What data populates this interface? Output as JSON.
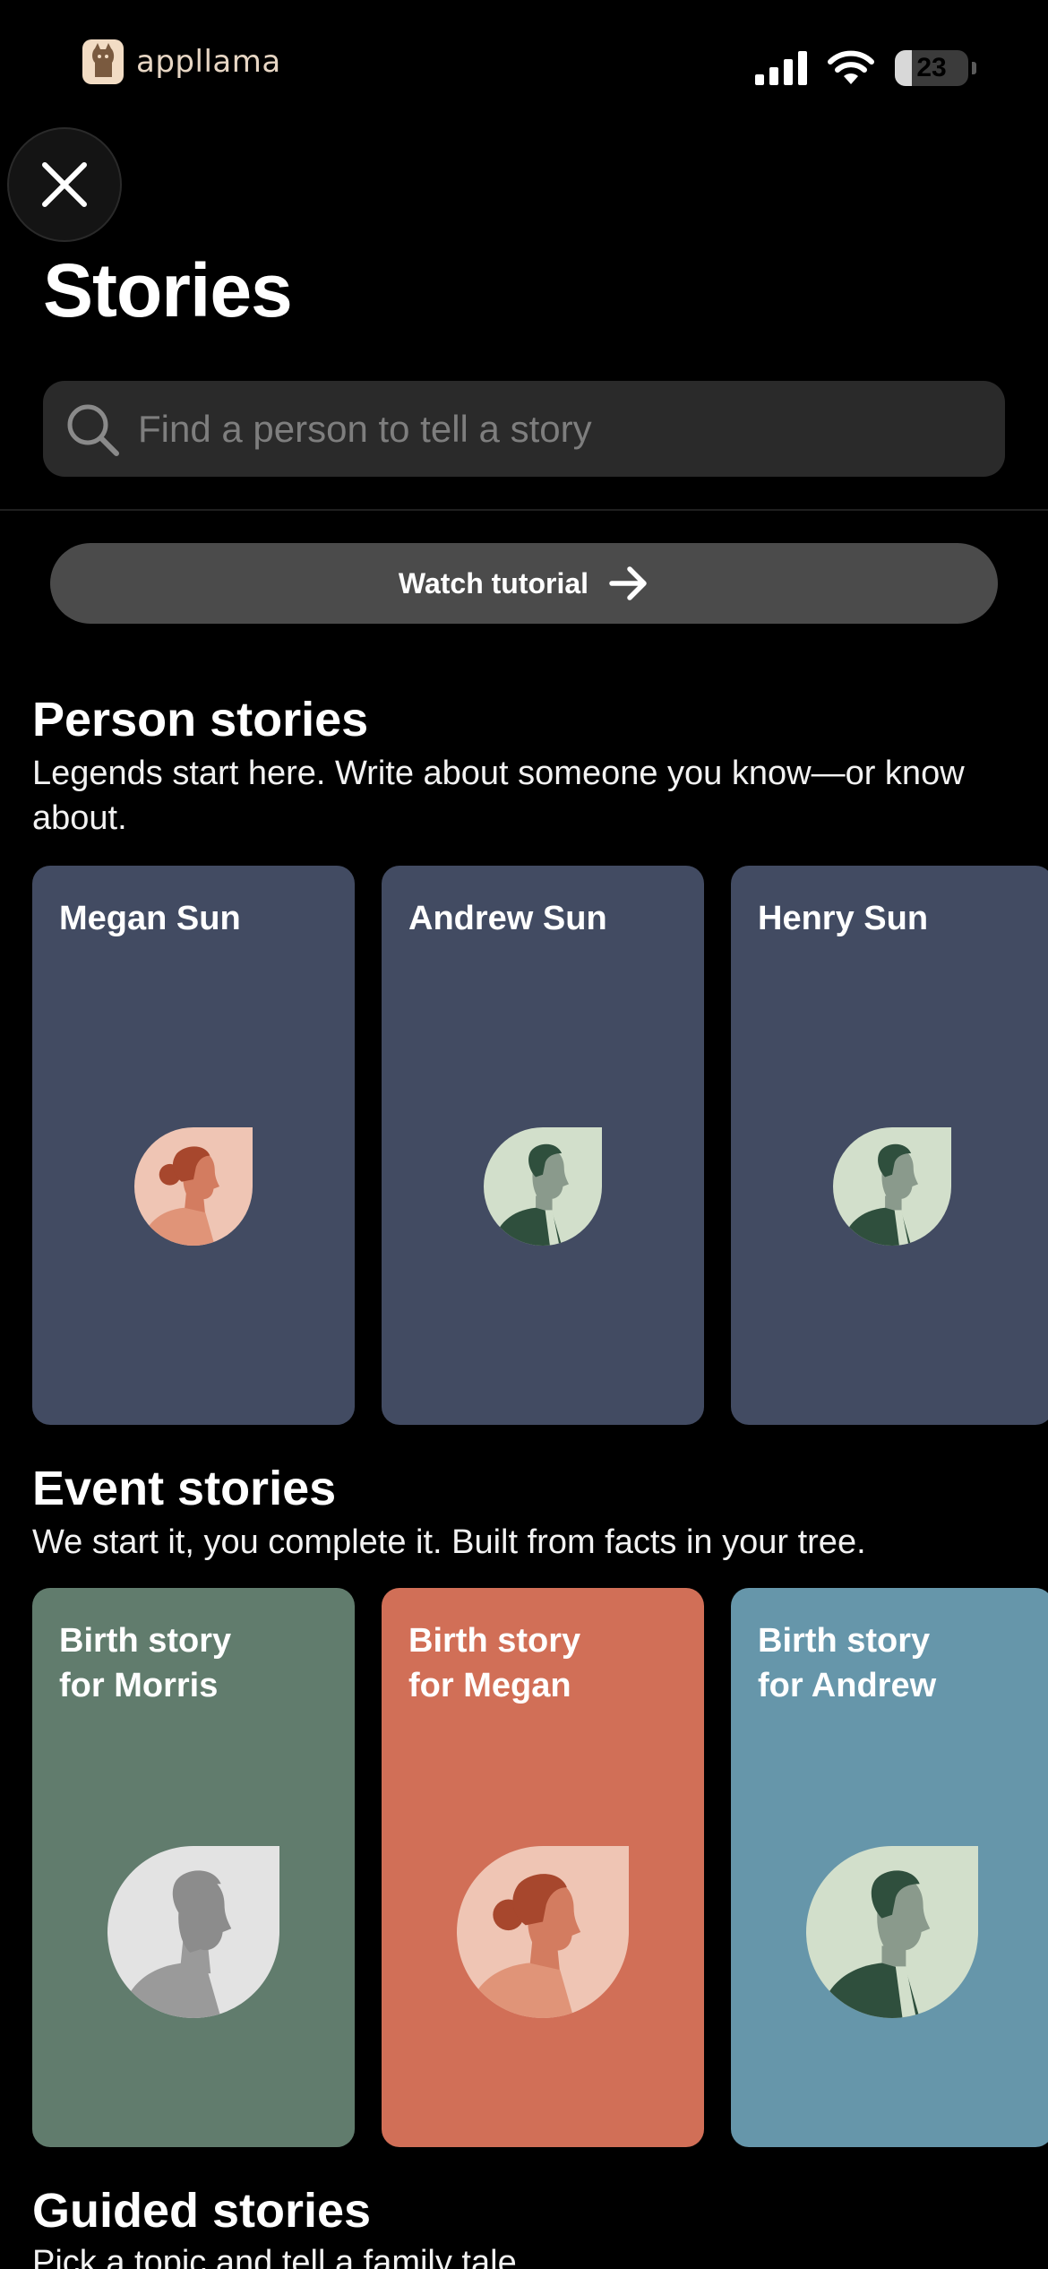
{
  "status_bar": {
    "brand": "appllama",
    "battery": "23",
    "battery_level": 0.23
  },
  "page": {
    "title": "Stories"
  },
  "search": {
    "placeholder": "Find a person to tell a story"
  },
  "tutorial": {
    "label": "Watch tutorial"
  },
  "person_stories": {
    "title": "Person stories",
    "description": "Legends start here. Write about someone you know—or know about.",
    "cards": [
      {
        "name": "Megan Sun",
        "avatar": "woman-avatar-icon",
        "color": "#424b62"
      },
      {
        "name": "Andrew Sun",
        "avatar": "man-avatar-icon",
        "color": "#424b62"
      },
      {
        "name": "Henry Sun",
        "avatar": "man-avatar-icon",
        "color": "#424b62"
      }
    ]
  },
  "event_stories": {
    "title": "Event stories",
    "description": "We start it, you complete it. Built from facts in your tree.",
    "cards": [
      {
        "line1": "Birth story",
        "line2": "for Morris",
        "avatar": "unknown-person-avatar-icon",
        "color": "#617c6d"
      },
      {
        "line1": "Birth story",
        "line2": "for Megan",
        "avatar": "woman-avatar-icon",
        "color": "#d16f57"
      },
      {
        "line1": "Birth story",
        "line2": "for Andrew",
        "avatar": "man-avatar-icon",
        "color": "#6696aa"
      }
    ]
  },
  "guided_stories": {
    "title": "Guided stories",
    "description": "Pick a topic and tell a family tale."
  }
}
